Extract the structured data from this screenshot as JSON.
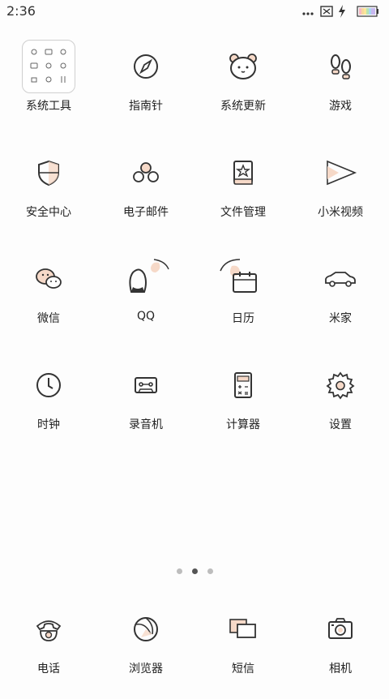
{
  "status_bar": {
    "time": "2:36",
    "icons": [
      "more-dots-icon",
      "sim-blocked-icon",
      "charging-bolt-icon",
      "battery-icon"
    ]
  },
  "apps": [
    {
      "label": "系统工具",
      "icon": "folder-icon"
    },
    {
      "label": "指南针",
      "icon": "compass-icon"
    },
    {
      "label": "系统更新",
      "icon": "bear-update-icon"
    },
    {
      "label": "游戏",
      "icon": "footprints-icon"
    },
    {
      "label": "安全中心",
      "icon": "shield-icon"
    },
    {
      "label": "电子邮件",
      "icon": "email-icon"
    },
    {
      "label": "文件管理",
      "icon": "book-star-icon"
    },
    {
      "label": "小米视频",
      "icon": "play-icon"
    },
    {
      "label": "微信",
      "icon": "wechat-icon"
    },
    {
      "label": "QQ",
      "icon": "qq-penguin-icon"
    },
    {
      "label": "日历",
      "icon": "calendar-icon"
    },
    {
      "label": "米家",
      "icon": "car-icon"
    },
    {
      "label": "时钟",
      "icon": "clock-icon"
    },
    {
      "label": "录音机",
      "icon": "cassette-icon"
    },
    {
      "label": "计算器",
      "icon": "calculator-icon"
    },
    {
      "label": "设置",
      "icon": "gear-icon"
    }
  ],
  "pager": {
    "pages": 3,
    "active_index": 1
  },
  "dock": [
    {
      "label": "电话",
      "icon": "phone-icon"
    },
    {
      "label": "浏览器",
      "icon": "browser-icon"
    },
    {
      "label": "短信",
      "icon": "message-icon"
    },
    {
      "label": "相机",
      "icon": "camera-icon"
    }
  ],
  "colors": {
    "accent": "#f6d9c8",
    "stroke": "#333333",
    "background": "#fdfdfd"
  }
}
